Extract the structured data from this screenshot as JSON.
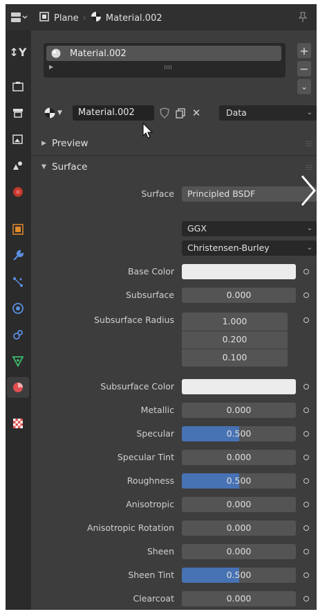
{
  "header": {
    "object_name": "Plane",
    "material_name": "Material.002"
  },
  "slots": {
    "items": [
      "Material.002"
    ],
    "add_label": "+",
    "remove_label": "−",
    "more_label": "⌄"
  },
  "material_bar": {
    "name": "Material.002",
    "link": "Data"
  },
  "sections": {
    "preview": "Preview",
    "surface": "Surface"
  },
  "surface": {
    "shader_label": "Surface",
    "shader_value": "Principled BSDF",
    "distribution": "GGX",
    "subsurface_method": "Christensen-Burley"
  },
  "properties": {
    "base_color": {
      "label": "Base Color",
      "color": "#ececec"
    },
    "subsurface": {
      "label": "Subsurface",
      "value": "0.000"
    },
    "subsurface_radius": {
      "label": "Subsurface Radius",
      "values": [
        "1.000",
        "0.200",
        "0.100"
      ]
    },
    "subsurface_color": {
      "label": "Subsurface Color",
      "color": "#ececec"
    },
    "metallic": {
      "label": "Metallic",
      "value": "0.000",
      "fraction": 0
    },
    "specular": {
      "label": "Specular",
      "value": "0.500",
      "fraction": 0.5
    },
    "specular_tint": {
      "label": "Specular Tint",
      "value": "0.000",
      "fraction": 0
    },
    "roughness": {
      "label": "Roughness",
      "value": "0.500",
      "fraction": 0.5
    },
    "anisotropic": {
      "label": "Anisotropic",
      "value": "0.000",
      "fraction": 0
    },
    "anisotropic_rotation": {
      "label": "Anisotropic Rotation",
      "value": "0.000",
      "fraction": 0
    },
    "sheen": {
      "label": "Sheen",
      "value": "0.000",
      "fraction": 0
    },
    "sheen_tint": {
      "label": "Sheen Tint",
      "value": "0.500",
      "fraction": 0.5
    },
    "clearcoat": {
      "label": "Clearcoat",
      "value": "0.000",
      "fraction": 0
    }
  },
  "colors": {
    "accent": "#4772b3",
    "panel": "#3d3d3d",
    "sidebar": "#2b2b2b",
    "field": "#545454"
  },
  "icons": {
    "editor_type": "properties-editor-icon",
    "object": "object-icon",
    "material": "material-sphere-icon",
    "pin": "pin-icon"
  }
}
